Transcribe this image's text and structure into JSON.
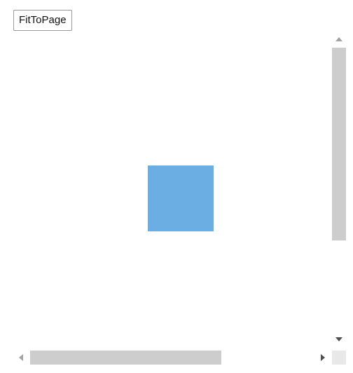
{
  "toolbar": {
    "fit_to_page_label": "FitToPage"
  },
  "canvas": {
    "shape": {
      "kind": "square",
      "fill_color": "#6aaee3"
    }
  },
  "scrollbars": {
    "vertical": {
      "up_icon": "arrow-up-icon",
      "down_icon": "arrow-down-icon",
      "thumb_color": "#cdcdcd",
      "position": 0.0,
      "visible_fraction": 0.62
    },
    "horizontal": {
      "left_icon": "arrow-left-icon",
      "right_icon": "arrow-right-icon",
      "thumb_color": "#cdcdcd",
      "position": 0.0,
      "visible_fraction": 0.6
    }
  }
}
